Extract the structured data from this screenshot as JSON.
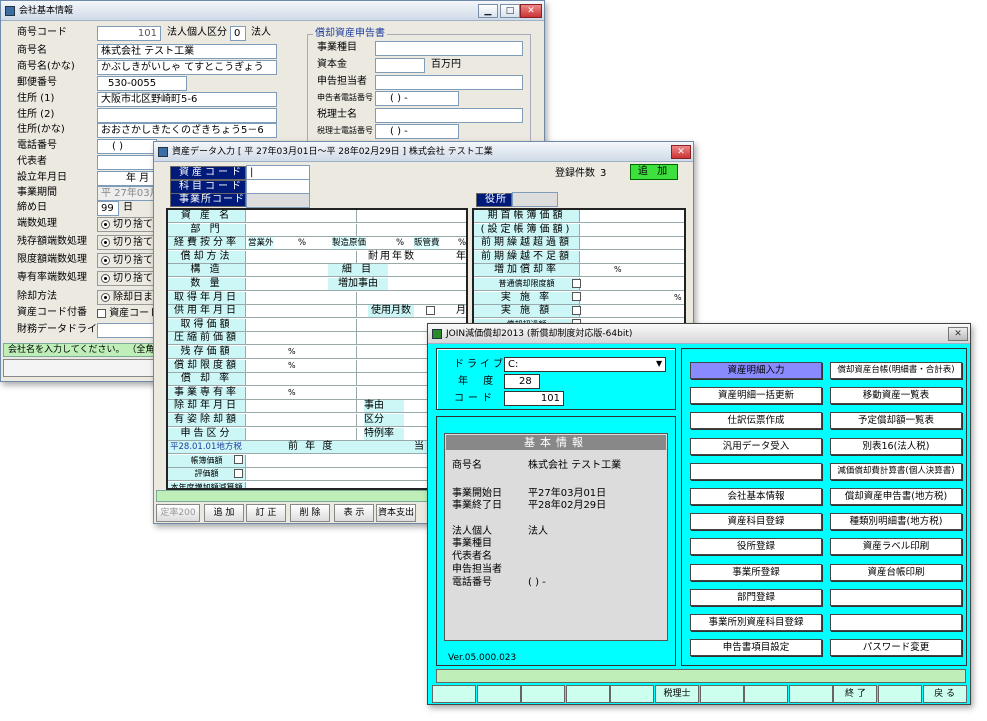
{
  "company_window": {
    "title": "会社基本情報",
    "left_labels": [
      "商号コード",
      "商号名",
      "商号名(かな)",
      "郵便番号",
      "住所 (1)",
      "住所 (2)",
      "住所(かな)",
      "電話番号",
      "代表者",
      "設立年月日",
      "事業期間",
      "締め日",
      "端数処理",
      "残存額端数処理",
      "限度額端数処理",
      "専有率端数処理",
      "除却方法",
      "資産コード付番",
      "財務データドライブ"
    ],
    "code_value": "101",
    "type_label": "法人個人区分",
    "type_code": "0",
    "type_value": "法人",
    "name_value": "株式会社 テスト工業",
    "kana_value": "かぶしきがいしゃ てすとこうぎょう",
    "postal_value": "530-0055",
    "address1_value": "大阪市北区野崎町5-6",
    "address_kana_value": "おおさかしきたくのざきちょう5－6",
    "phone_value": "(      )",
    "founded_value": "年   月",
    "period_value": "平 27年03月",
    "closing_value": "99",
    "closing_unit": "日",
    "rounding_option": "切り捨て",
    "residual_option": "切り捨て",
    "limit_option": "切り捨て",
    "exclusive_option": "切り捨て",
    "disposal_option": "除却日ま",
    "asset_code_option": "資産コード",
    "group_title": "償却資産申告書",
    "group_labels": [
      "事業種目",
      "資本金",
      "申告担当者",
      "申告者電話番号",
      "税理士名",
      "税理士電話番号"
    ],
    "capital_unit": "百万円",
    "phone_placeholder": "(      )  -",
    "tax_phone_placeholder": "(      )  -",
    "status_text": "会社名を入力してください。 （全角20文"
  },
  "asset_window": {
    "title": "資産データ入力  [ 平 27年03月01日～平 28年02月29日 ]  株式会社  テスト工業",
    "nav_labels": [
      "資産コード",
      "科目コード",
      "事業所コード"
    ],
    "count_label": "登録件数",
    "count_value": "3",
    "mode_badge": "追 加",
    "office_label": "役所",
    "left_rows": [
      "資 産 名",
      "部 門",
      "経費按分率",
      "償却方法",
      "構 造",
      "数 量",
      "取得年月日",
      "供用年月日",
      "取得価額",
      "圧縮前価額",
      "残存価額",
      "償却限度額",
      "償 却 率",
      "事業専有率",
      "除却年月日",
      "有姿除却額",
      "申告区分"
    ],
    "expense_cells": [
      "営業外",
      "%",
      "製造原価",
      "%",
      "販管費",
      "%"
    ],
    "life_label": "耐用年数",
    "life_unit": "年",
    "detail_label": "細  目",
    "reason_label": "増加事由",
    "use_months_label": "使用月数",
    "use_months_unit": "月",
    "pct_sign": "%",
    "reason2_label": "事由",
    "category_label": "区分",
    "special_label": "特例率",
    "local_tax_label": "平28.01.01地方税",
    "prev_year": "前 年 度",
    "this_year": "当 年",
    "local_rows": [
      "帳簿価額",
      "評価額",
      "本年度増加額減算額"
    ],
    "right_rows": [
      "期首帳簿価額",
      "(設定帳簿価額)",
      "前期繰越超過額",
      "前期繰越不足額",
      "増加償却率",
      "普通償却限度額",
      "実 施 率",
      "実 施 額",
      "償却超過額"
    ],
    "func_keys": [
      "定率200",
      "追 加",
      "訂 正",
      "削 除",
      "表 示",
      "資本支出"
    ]
  },
  "join_window": {
    "title": "JOIN減価償却2013   (新償却制度対応版-64bit)",
    "drive_label": "ドライブ",
    "drive_value": "C:",
    "year_label": "年 度",
    "year_value": "28",
    "code_label": "コード",
    "code_value": "101",
    "info_title": "基本情報",
    "info_rows": [
      {
        "label": "商号名",
        "value": "株式会社 テスト工業"
      },
      {
        "label": "事業開始日",
        "value": "平27年03月01日"
      },
      {
        "label": "事業終了日",
        "value": "平28年02月29日"
      },
      {
        "label": "法人個人",
        "value": "法人"
      },
      {
        "label": "事業種目",
        "value": ""
      },
      {
        "label": "代表者名",
        "value": ""
      },
      {
        "label": "申告担当者",
        "value": ""
      },
      {
        "label": "電話番号",
        "value": "(      )  -"
      }
    ],
    "version": "Ver.05.000.023",
    "menu_left": [
      "資産明細入力",
      "資産明細一括更新",
      "仕訳伝票作成",
      "汎用データ受入",
      "",
      "会社基本情報",
      "資産科目登録",
      "役所登録",
      "事業所登録",
      "部門登録",
      "事業所別資産科目登録",
      "申告書項目設定"
    ],
    "menu_right": [
      "償却資産台帳(明細書・合計表)",
      "移動資産一覧表",
      "予定償却額一覧表",
      "別表16(法人税)",
      "減価償却費計算書(個人決算書)",
      "償却資産申告書(地方税)",
      "種類別明細書(地方税)",
      "資産ラベル印刷",
      "資産台帳印刷",
      "",
      "",
      "パスワード変更"
    ],
    "status_items": [
      "",
      "",
      "",
      "",
      "",
      "税理士",
      "",
      "",
      "",
      "終 了",
      "",
      "戻 る"
    ]
  }
}
